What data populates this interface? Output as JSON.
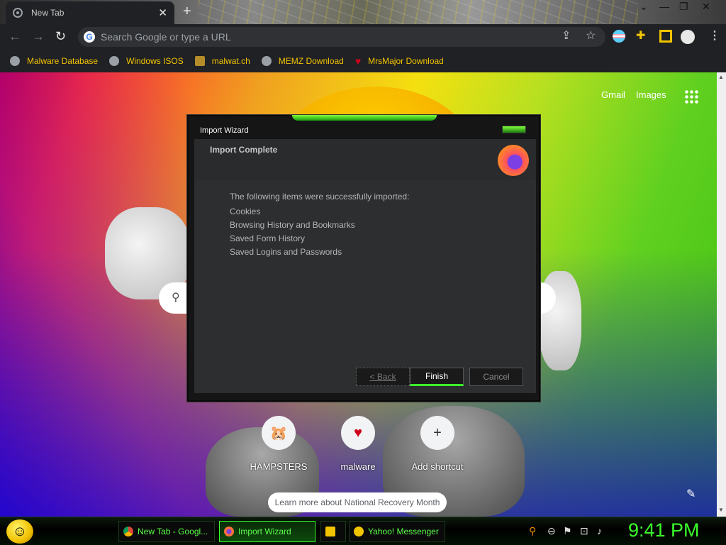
{
  "browser": {
    "tab_title": "New Tab",
    "tab_close": "✕",
    "new_tab": "+",
    "omnibox_placeholder": "Search Google or type a URL",
    "window_controls": [
      "⌄",
      "—",
      "❐",
      "✕"
    ]
  },
  "bookmarks": [
    {
      "label": "Malware Database",
      "icon": "globe-icon"
    },
    {
      "label": "Windows ISOS",
      "icon": "globe-icon"
    },
    {
      "label": "malwat.ch",
      "icon": "figure-icon"
    },
    {
      "label": "MEMZ Download",
      "icon": "globe-icon"
    },
    {
      "label": "MrsMajor Download",
      "icon": "heart-icon"
    }
  ],
  "newtab": {
    "gmail": "Gmail",
    "images": "Images",
    "shortcuts": [
      {
        "label": "HAMPSTERS",
        "icon": "🐹"
      },
      {
        "label": "malware",
        "icon": "♥"
      },
      {
        "label": "Add shortcut",
        "icon": "+"
      }
    ],
    "learn_more": "Learn more about National Recovery Month"
  },
  "dialog": {
    "title": "Import Wizard",
    "heading": "Import Complete",
    "intro": "The following items were successfully imported:",
    "items": [
      "Cookies",
      "Browsing History and Bookmarks",
      "Saved Form History",
      "Saved Logins and Passwords"
    ],
    "back": "< Back",
    "finish": "Finish",
    "cancel": "Cancel"
  },
  "taskbar": {
    "items": [
      {
        "label": "New Tab - Googl...",
        "icon": "chrome-icon"
      },
      {
        "label": "Import Wizard",
        "icon": "firefox-icon"
      },
      {
        "label": "",
        "icon": "folder-icon"
      },
      {
        "label": "Yahoo! Messenger",
        "icon": "yahoo-smiley-icon"
      }
    ],
    "clock": "9:41 PM"
  }
}
